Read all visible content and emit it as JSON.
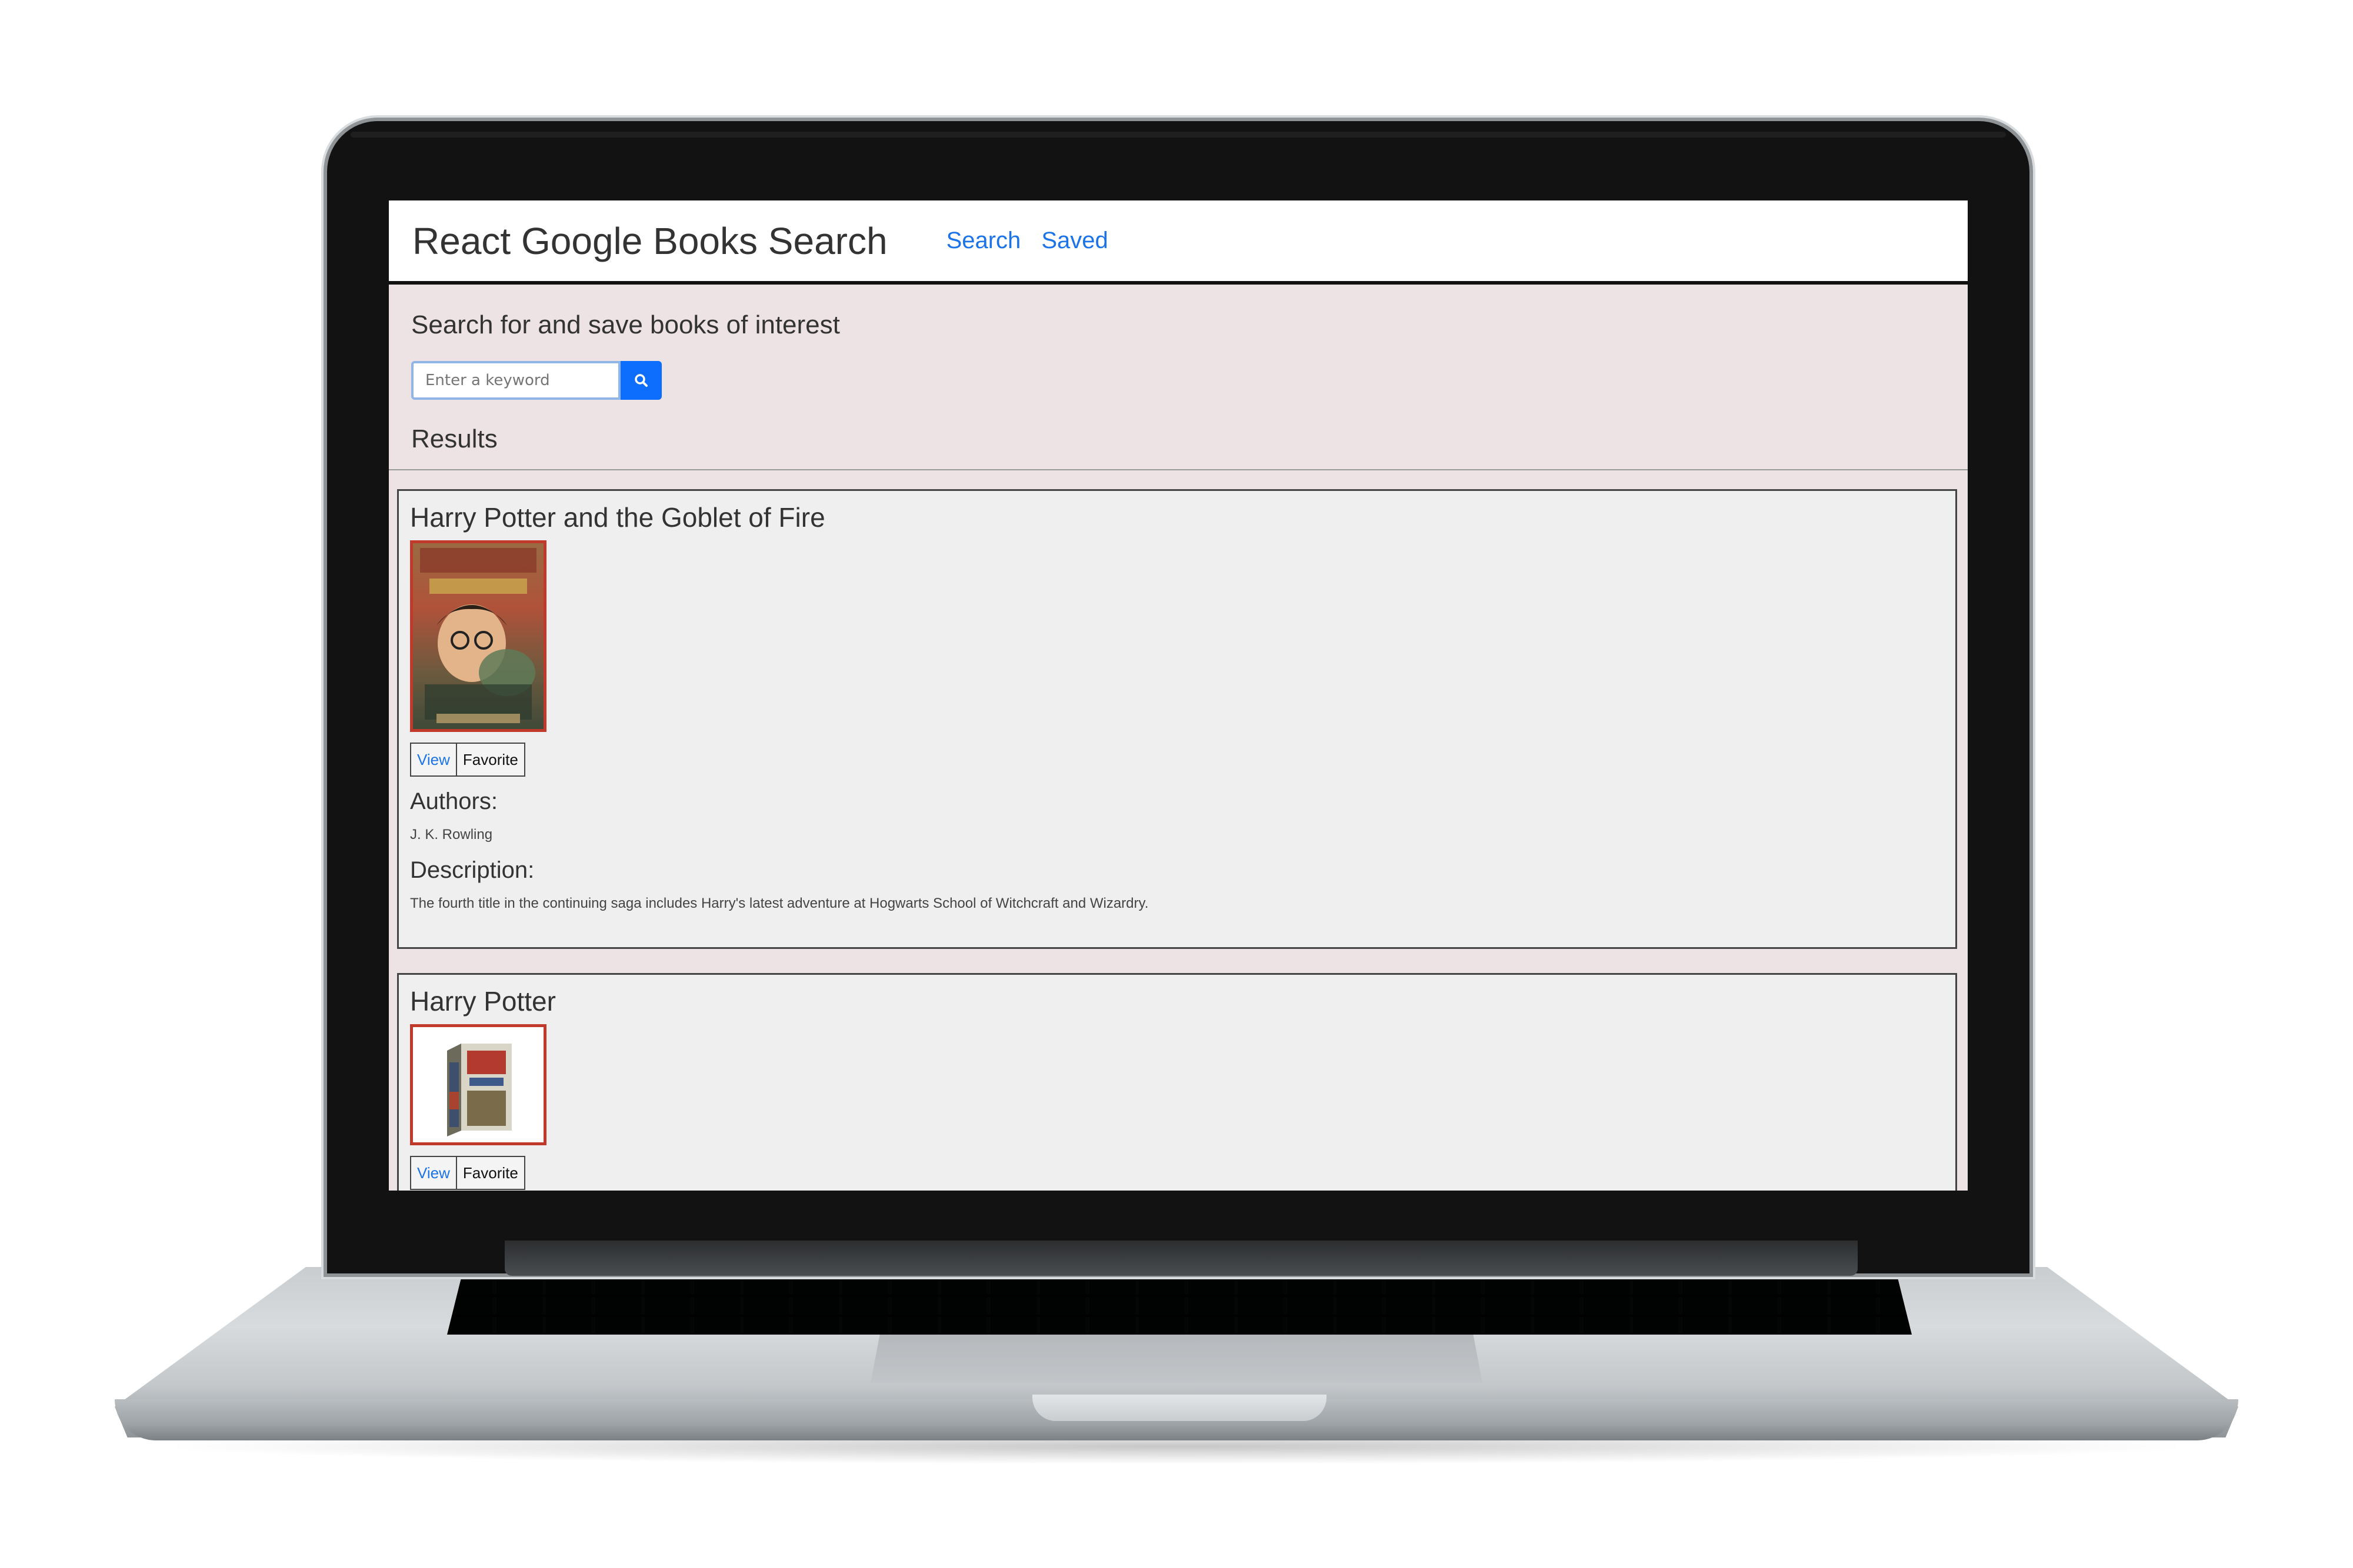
{
  "navbar": {
    "brand": "React Google Books Search",
    "links": [
      "Search",
      "Saved"
    ]
  },
  "jumbotron": {
    "tagline": "Search for and save books of interest"
  },
  "search": {
    "placeholder": "Enter a keyword",
    "icon": "search-icon"
  },
  "results": {
    "heading": "Results",
    "books": [
      {
        "title": "Harry Potter and the Goblet of Fire",
        "view_label": "View",
        "favorite_label": "Favorite",
        "authors_label": "Authors:",
        "authors": "J. K. Rowling",
        "description_label": "Description:",
        "description": "The fourth title in the continuing saga includes Harry's latest adventure at Hogwarts School of Witchcraft and Wizardry."
      },
      {
        "title": "Harry Potter",
        "view_label": "View",
        "favorite_label": "Favorite"
      }
    ]
  },
  "colors": {
    "link": "#1a73e8",
    "page_bg": "#eee3e4",
    "thumb_border": "#c0392b",
    "button_primary": "#0d6efd"
  }
}
